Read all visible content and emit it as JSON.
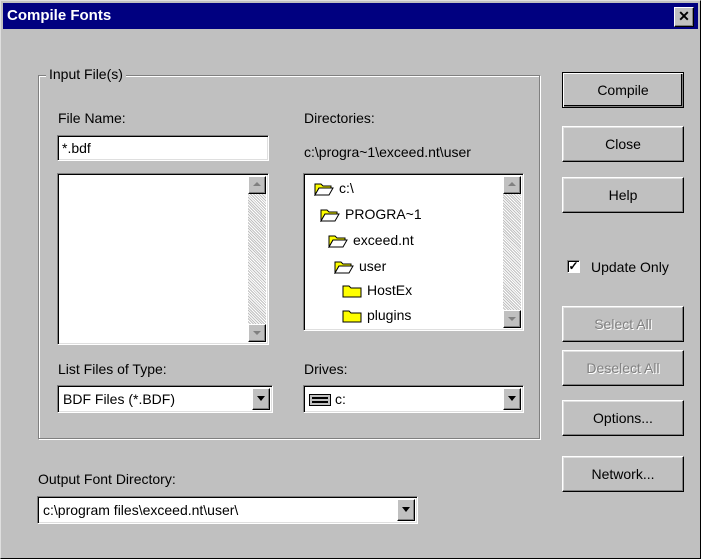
{
  "window": {
    "title": "Compile Fonts",
    "close_glyph": "✕"
  },
  "input_group": {
    "label": "Input File(s)",
    "file_name_label": "File Name:",
    "file_name_value": "*.bdf",
    "directories_label": "Directories:",
    "current_directory": "c:\\progra~1\\exceed.nt\\user",
    "directory_tree": [
      {
        "name": "c:\\",
        "icon": "open-folder-icon"
      },
      {
        "name": "PROGRA~1",
        "icon": "open-folder-icon"
      },
      {
        "name": "exceed.nt",
        "icon": "open-folder-icon"
      },
      {
        "name": "user",
        "icon": "open-folder-icon"
      },
      {
        "name": "HostEx",
        "icon": "folder-icon"
      },
      {
        "name": "plugins",
        "icon": "folder-icon"
      }
    ],
    "list_files_of_type_label": "List Files of Type:",
    "file_type_value": "BDF Files (*.BDF)",
    "drives_label": "Drives:",
    "drive_value": "c:"
  },
  "output": {
    "label": "Output Font Directory:",
    "value": "c:\\program files\\exceed.nt\\user\\"
  },
  "buttons": {
    "compile": "Compile",
    "close": "Close",
    "help": "Help",
    "select_all": "Select All",
    "deselect_all": "Deselect All",
    "options": "Options...",
    "network": "Network..."
  },
  "update_only": {
    "label": "Update Only",
    "checked": true,
    "check_glyph": "✓"
  },
  "colors": {
    "title_bar": "#000080",
    "face": "#c0c0c0",
    "disabled_text": "#808080",
    "folder": "#ffff00"
  }
}
